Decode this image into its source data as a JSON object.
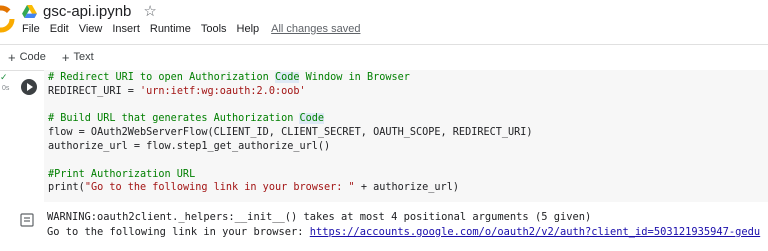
{
  "app": {
    "file_title": "gsc-api.ipynb",
    "star_icon": "star-outline-icon",
    "drive_icon": "google-drive-icon"
  },
  "menu": {
    "items": [
      "File",
      "Edit",
      "View",
      "Insert",
      "Runtime",
      "Tools",
      "Help"
    ],
    "save_status": "All changes saved"
  },
  "toolbar": {
    "add_code_label": "Code",
    "add_text_label": "Text"
  },
  "cell": {
    "status_icon": "check-icon",
    "exec_time": "0s",
    "run_icon": "play-circle-icon",
    "code": {
      "line1_comment_a": "# Redirect URI to open Authorization ",
      "line1_highlight": "Code",
      "line1_comment_b": " Window in Browser",
      "line2_var": "REDIRECT_URI = ",
      "line2_str": "'urn:ietf:wg:oauth:2.0:oob'",
      "line4_comment_a": "# Build URL that generates Authorization ",
      "line4_highlight": "Code",
      "line5": "flow = OAuth2WebServerFlow(CLIENT_ID, CLIENT_SECRET, OAUTH_SCOPE, REDIRECT_URI)",
      "line6": "authorize_url = flow.step1_get_authorize_url()",
      "line8_comment": "#Print Authorization URL",
      "line9_a": "print(",
      "line9_str": "\"Go to the following link in your browser: \"",
      "line9_b": " + authorize_url)"
    }
  },
  "output": {
    "icon": "output-terminal-icon",
    "warning": "WARNING:oauth2client._helpers:__init__() takes at most 4 positional arguments (5 given)",
    "go_prefix": "Go to the following link in your browser: ",
    "link_text": "https://accounts.google.com/o/oauth2/v2/auth?client_id=503121935947-gedu"
  },
  "colors": {
    "comment": "#007f00",
    "string": "#a31515",
    "link": "#1a0dab",
    "cell_bg": "#f7f7f7"
  }
}
